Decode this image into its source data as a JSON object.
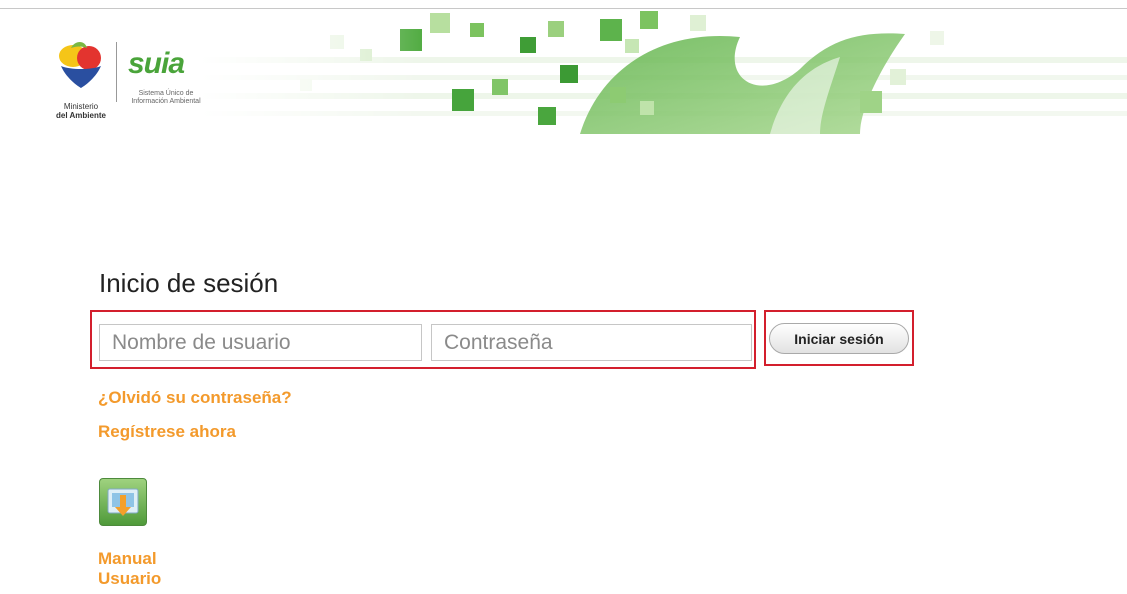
{
  "header": {
    "ministerio": {
      "line1": "Ministerio",
      "line2": "del Ambiente"
    },
    "suia": {
      "wordmark": "suia",
      "subtitle_line1": "Sistema Único de",
      "subtitle_line2": "Información Ambiental"
    },
    "banner_colors": [
      "#3fa33a",
      "#6cbf4a",
      "#a6d98a",
      "#d8efcb"
    ]
  },
  "login": {
    "title": "Inicio de sesión",
    "username": {
      "value": "",
      "placeholder": "Nombre de usuario"
    },
    "password": {
      "value": "",
      "placeholder": "Contraseña"
    },
    "submit_label": "Iniciar sesión",
    "highlight_color": "#d31f2d"
  },
  "links": {
    "forgot": "¿Olvidó su contraseña?",
    "register": "Regístrese ahora",
    "color": "#f39a2c"
  },
  "manual": {
    "icon": "download-folder-icon",
    "label_line1": "Manual",
    "label_line2": "Usuario"
  }
}
